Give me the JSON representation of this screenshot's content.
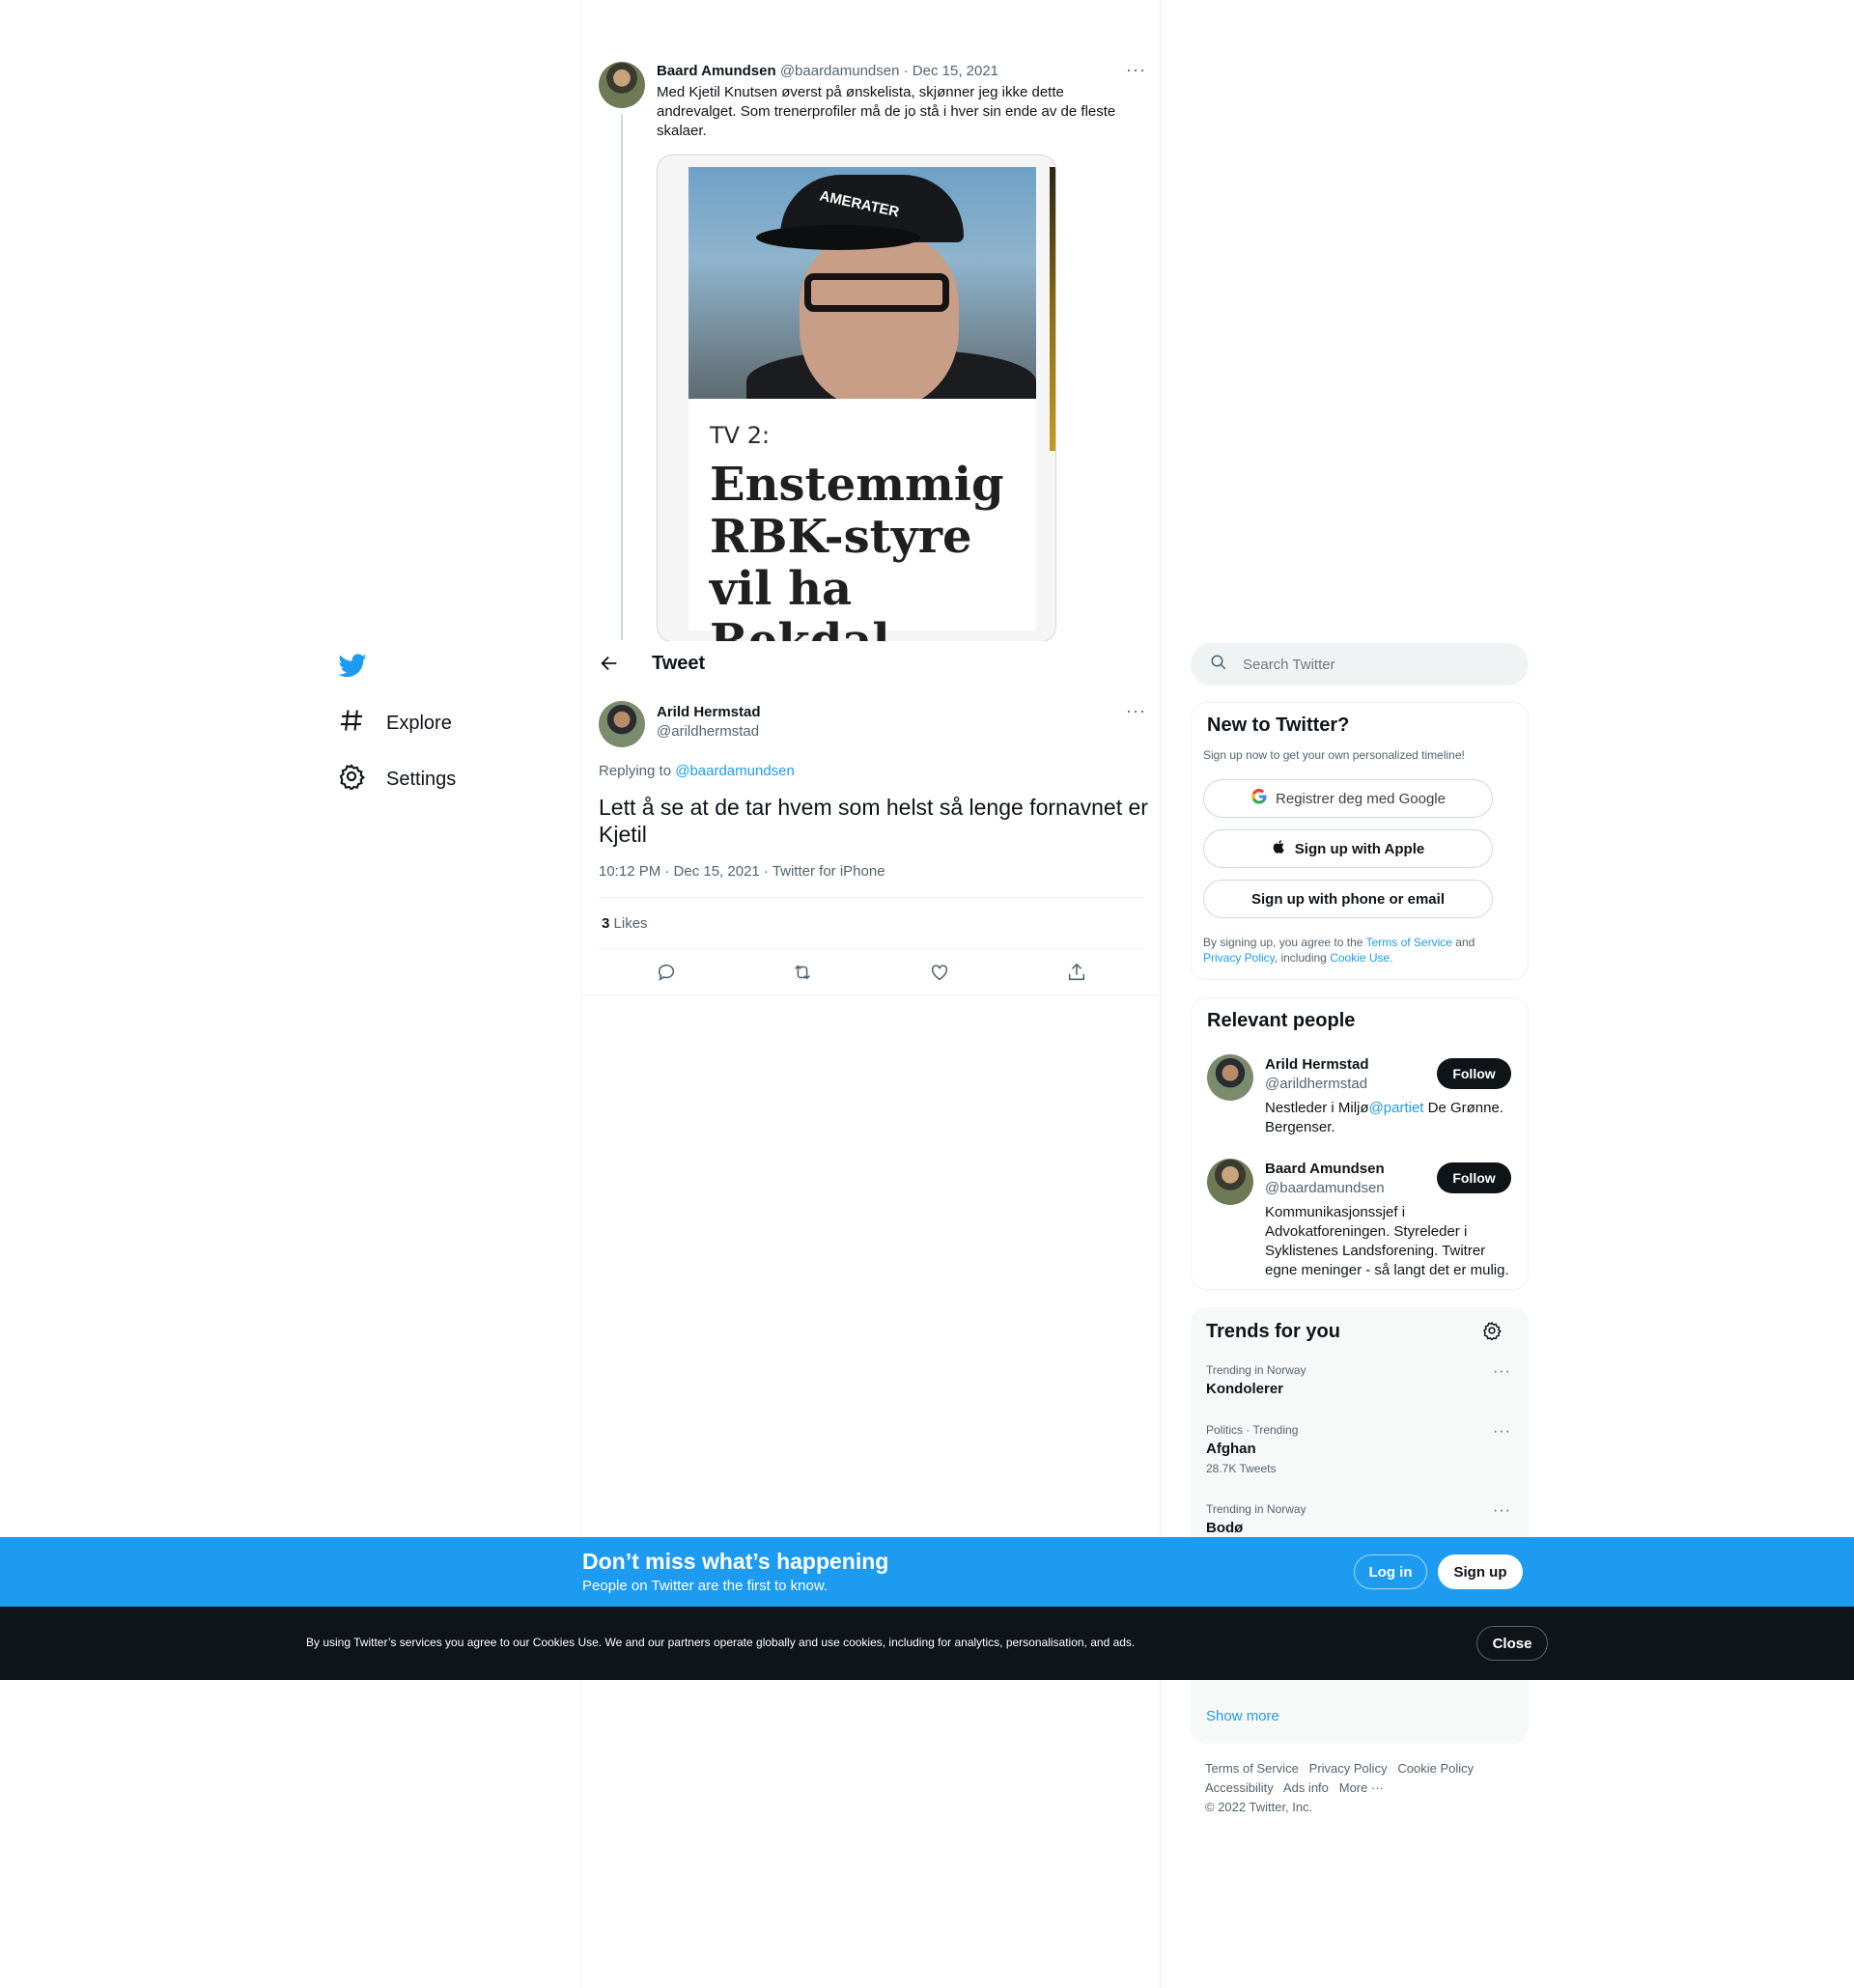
{
  "nav": {
    "explore_label": "Explore",
    "settings_label": "Settings"
  },
  "header": {
    "title": "Tweet"
  },
  "parent_tweet": {
    "name": "Baard Amundsen",
    "handle": "@baardamundsen",
    "date": "· Dec 15, 2021",
    "text": "Med Kjetil Knutsen øverst på ønskelista, skjønner jeg ikke dette andrevalget. Som trenerprofiler må de jo stå i hver sin ende av de fleste skalaer.",
    "card": {
      "kicker": "TV 2:",
      "headline": "Enstemmig RBK-styre vil ha Rekdal",
      "cap_text": "AMERATER"
    }
  },
  "main_tweet": {
    "name": "Arild Hermstad",
    "handle": "@arildhermstad",
    "replying_prefix": "Replying to",
    "replying_handle": "@baardamundsen",
    "text": "Lett å se at de tar hvem som helst så lenge fornavnet er Kjetil",
    "meta": "10:12 PM · Dec 15, 2021 · Twitter for iPhone",
    "likes_count": "3",
    "likes_label": "Likes"
  },
  "search": {
    "placeholder": "Search Twitter"
  },
  "signup_panel": {
    "title": "New to Twitter?",
    "subtitle": "Sign up now to get your own personalized timeline!",
    "google_label": "Registrer deg med Google",
    "apple_label": "Sign up with Apple",
    "email_label": "Sign up with phone or email",
    "legal_1": "By signing up, you agree to the",
    "terms": "Terms of Service",
    "legal_2": "and",
    "privacy": "Privacy Policy",
    "legal_3": ", including",
    "cookie": "Cookie Use."
  },
  "relevant": {
    "title": "Relevant people",
    "people": [
      {
        "name": "Arild Hermstad",
        "handle": "@arildhermstad",
        "follow": "Follow",
        "bio_1": "Nestleder i Miljø",
        "bio_link": "@partiet",
        "bio_2": " De Grønne. Bergenser."
      },
      {
        "name": "Baard Amundsen",
        "handle": "@baardamundsen",
        "follow": "Follow",
        "bio": "Kommunikasjonssjef i Advokatforeningen. Styreleder i Syklistenes Landsforening. Twitrer egne meninger - så langt det er mulig."
      }
    ]
  },
  "trends": {
    "title": "Trends for you",
    "items": [
      {
        "context": "Trending in Norway",
        "name": "Kondolerer",
        "count": ""
      },
      {
        "context": "Politics · Trending",
        "name": "Afghan",
        "count": "28.7K Tweets"
      },
      {
        "context": "Trending in Norway",
        "name": "Bodø",
        "count": ""
      }
    ],
    "show_more": "Show more"
  },
  "footer": {
    "links": [
      "Terms of Service",
      "Privacy Policy",
      "Cookie Policy",
      "Accessibility",
      "Ads info",
      "More ···"
    ],
    "copyright": "© 2022 Twitter, Inc."
  },
  "banner": {
    "title": "Don’t miss what’s happening",
    "subtitle": "People on Twitter are the first to know.",
    "login": "Log in",
    "signup": "Sign up"
  },
  "cookie_bar": {
    "text": "By using Twitter’s services you agree to our Cookies Use. We and our partners operate globally and use cookies, including for analytics, personalisation, and ads.",
    "close": "Close"
  },
  "colors": {
    "accent": "#1d9bf0",
    "dark": "#0f1419",
    "cookie_bg": "#0f1419"
  }
}
